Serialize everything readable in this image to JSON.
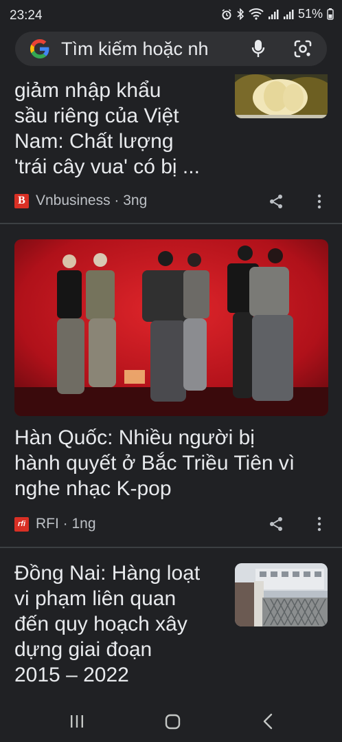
{
  "status": {
    "time": "23:24",
    "battery": "51%",
    "icons": [
      "alarm-icon",
      "bluetooth-icon",
      "wifi-icon",
      "signal-icon",
      "signal-icon",
      "battery-icon"
    ]
  },
  "search": {
    "text": "Tìm kiếm hoặc nh",
    "icons": [
      "google-logo",
      "mic-icon",
      "lens-icon"
    ]
  },
  "feed": [
    {
      "title": "giảm nhập khẩu\nsầu riêng của Việt\nNam: Chất lượng\n'trái cây vua' có bị ...",
      "source": "Vnbusiness",
      "source_logo": "B",
      "age": "3ng",
      "thumbnail": "durian-photo"
    },
    {
      "title": "Hàn Quốc: Nhiều người bị\nhành quyết ở Bắc Triều Tiên vì\nnghe nhạc K-pop",
      "source": "RFI",
      "source_logo": "rfi",
      "age": "1ng",
      "thumbnail": "kpop-dancers-on-red-stage"
    },
    {
      "title": "Đồng Nai: Hàng loạt\nvi phạm liên quan\nđến quy hoạch xây\ndựng giai đoạn\n2015 – 2022",
      "thumbnail": "government-building-gate"
    }
  ],
  "colors": {
    "background": "#202124",
    "search_bg": "#303134",
    "text": "#e8eaed",
    "meta": "#bdc1c6",
    "divider": "#3c4043",
    "stage_red": "#c4161c"
  },
  "separator": " · "
}
